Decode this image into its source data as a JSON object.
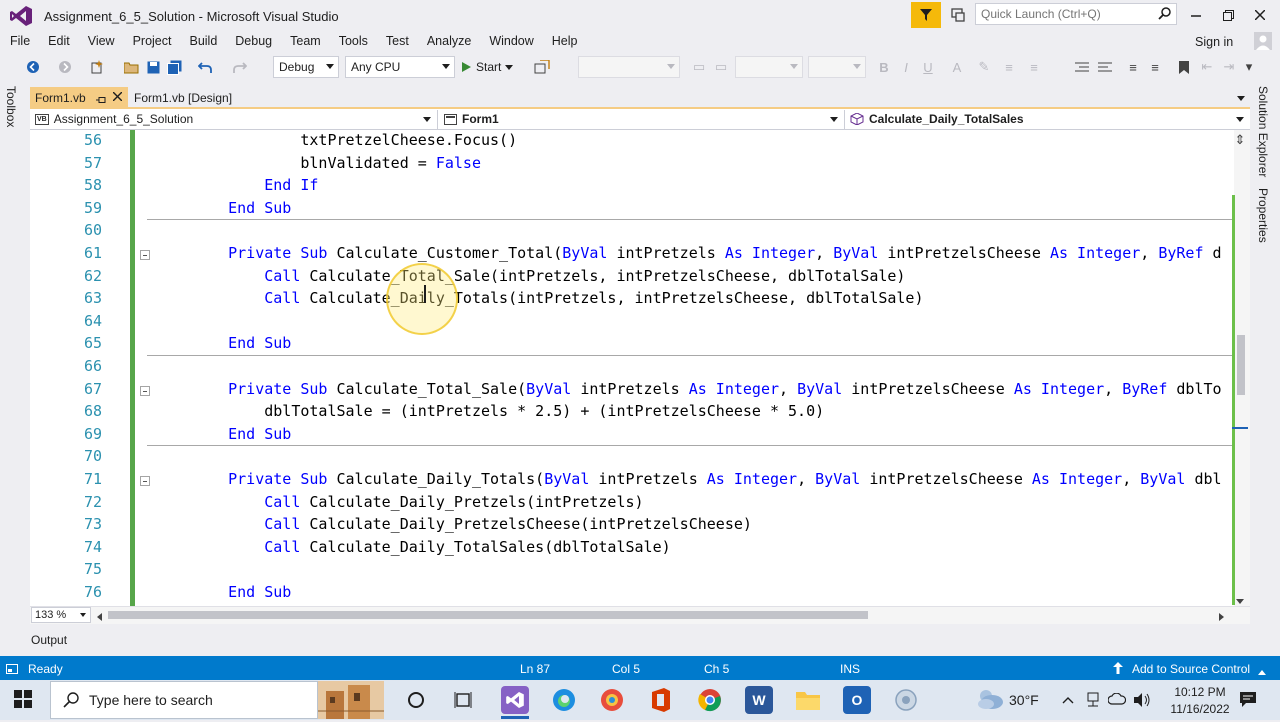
{
  "window": {
    "title": "Assignment_6_5_Solution - Microsoft Visual Studio",
    "quick_launch_placeholder": "Quick Launch (Ctrl+Q)"
  },
  "menu": [
    "File",
    "Edit",
    "View",
    "Project",
    "Build",
    "Debug",
    "Team",
    "Tools",
    "Test",
    "Analyze",
    "Window",
    "Help"
  ],
  "sign_in": "Sign in",
  "toolbar": {
    "config": "Debug",
    "platform": "Any CPU",
    "start_label": "Start"
  },
  "side_panels": {
    "toolbox": "Toolbox",
    "solution_explorer": "Solution Explorer",
    "properties": "Properties"
  },
  "tabs": [
    {
      "label": "Form1.vb",
      "active": true
    },
    {
      "label": "Form1.vb [Design]",
      "active": false
    }
  ],
  "navbar": {
    "project_badge": "VB",
    "project": "Assignment_6_5_Solution",
    "class": "Form1",
    "member": "Calculate_Daily_TotalSales"
  },
  "editor": {
    "lines": [
      {
        "n": "56",
        "parts": [
          {
            "t": "            txtPretzelCheese.Focus()",
            "k": false
          }
        ]
      },
      {
        "n": "57",
        "parts": [
          {
            "t": "            blnValidated = ",
            "k": false
          },
          {
            "t": "False",
            "k": true
          }
        ]
      },
      {
        "n": "58",
        "parts": [
          {
            "t": "        ",
            "k": false
          },
          {
            "t": "End If",
            "k": true
          }
        ]
      },
      {
        "n": "59",
        "parts": [
          {
            "t": "    ",
            "k": false
          },
          {
            "t": "End Sub",
            "k": true
          }
        ]
      },
      {
        "n": "60",
        "parts": []
      },
      {
        "n": "61",
        "parts": [
          {
            "t": "    ",
            "k": false
          },
          {
            "t": "Private Sub",
            "k": true
          },
          {
            "t": " Calculate_Customer_Total(",
            "k": false
          },
          {
            "t": "ByVal",
            "k": true
          },
          {
            "t": " intPretzels ",
            "k": false
          },
          {
            "t": "As Integer",
            "k": true
          },
          {
            "t": ", ",
            "k": false
          },
          {
            "t": "ByVal",
            "k": true
          },
          {
            "t": " intPretzelsCheese ",
            "k": false
          },
          {
            "t": "As Integer",
            "k": true
          },
          {
            "t": ", ",
            "k": false
          },
          {
            "t": "ByRef",
            "k": true
          },
          {
            "t": " d",
            "k": false
          }
        ]
      },
      {
        "n": "62",
        "parts": [
          {
            "t": "        ",
            "k": false
          },
          {
            "t": "Call",
            "k": true
          },
          {
            "t": " Calculate_Total_Sale(intPretzels, intPretzelsCheese, dblTotalSale)",
            "k": false
          }
        ]
      },
      {
        "n": "63",
        "parts": [
          {
            "t": "        ",
            "k": false
          },
          {
            "t": "Call",
            "k": true
          },
          {
            "t": " Calculate_Daily_Totals(intPretzels, intPretzelsCheese, dblTotalSale)",
            "k": false
          }
        ]
      },
      {
        "n": "64",
        "parts": []
      },
      {
        "n": "65",
        "parts": [
          {
            "t": "    ",
            "k": false
          },
          {
            "t": "End Sub",
            "k": true
          }
        ]
      },
      {
        "n": "66",
        "parts": []
      },
      {
        "n": "67",
        "parts": [
          {
            "t": "    ",
            "k": false
          },
          {
            "t": "Private Sub",
            "k": true
          },
          {
            "t": " Calculate_Total_Sale(",
            "k": false
          },
          {
            "t": "ByVal",
            "k": true
          },
          {
            "t": " intPretzels ",
            "k": false
          },
          {
            "t": "As Integer",
            "k": true
          },
          {
            "t": ", ",
            "k": false
          },
          {
            "t": "ByVal",
            "k": true
          },
          {
            "t": " intPretzelsCheese ",
            "k": false
          },
          {
            "t": "As Integer",
            "k": true
          },
          {
            "t": ", ",
            "k": false
          },
          {
            "t": "ByRef",
            "k": true
          },
          {
            "t": " dblTo",
            "k": false
          }
        ]
      },
      {
        "n": "68",
        "parts": [
          {
            "t": "        dblTotalSale = (intPretzels * 2.5) + (intPretzelsCheese * 5.0)",
            "k": false
          }
        ]
      },
      {
        "n": "69",
        "parts": [
          {
            "t": "    ",
            "k": false
          },
          {
            "t": "End Sub",
            "k": true
          }
        ]
      },
      {
        "n": "70",
        "parts": []
      },
      {
        "n": "71",
        "parts": [
          {
            "t": "    ",
            "k": false
          },
          {
            "t": "Private Sub",
            "k": true
          },
          {
            "t": " Calculate_Daily_Totals(",
            "k": false
          },
          {
            "t": "ByVal",
            "k": true
          },
          {
            "t": " intPretzels ",
            "k": false
          },
          {
            "t": "As Integer",
            "k": true
          },
          {
            "t": ", ",
            "k": false
          },
          {
            "t": "ByVal",
            "k": true
          },
          {
            "t": " intPretzelsCheese ",
            "k": false
          },
          {
            "t": "As Integer",
            "k": true
          },
          {
            "t": ", ",
            "k": false
          },
          {
            "t": "ByVal",
            "k": true
          },
          {
            "t": " dbl",
            "k": false
          }
        ]
      },
      {
        "n": "72",
        "parts": [
          {
            "t": "        ",
            "k": false
          },
          {
            "t": "Call",
            "k": true
          },
          {
            "t": " Calculate_Daily_Pretzels(intPretzels)",
            "k": false
          }
        ]
      },
      {
        "n": "73",
        "parts": [
          {
            "t": "        ",
            "k": false
          },
          {
            "t": "Call",
            "k": true
          },
          {
            "t": " Calculate_Daily_PretzelsCheese(intPretzelsCheese)",
            "k": false
          }
        ]
      },
      {
        "n": "74",
        "parts": [
          {
            "t": "        ",
            "k": false
          },
          {
            "t": "Call",
            "k": true
          },
          {
            "t": " Calculate_Daily_TotalSales(dblTotalSale)",
            "k": false
          }
        ]
      },
      {
        "n": "75",
        "parts": []
      },
      {
        "n": "76",
        "parts": [
          {
            "t": "    ",
            "k": false
          },
          {
            "t": "End Sub",
            "k": true
          }
        ]
      }
    ],
    "zoom": "133 %"
  },
  "output_label": "Output",
  "status": {
    "ready": "Ready",
    "ln": "Ln 87",
    "col": "Col 5",
    "ch": "Ch 5",
    "ins": "INS",
    "source_control": "Add to Source Control"
  },
  "taskbar": {
    "search_placeholder": "Type here to search",
    "temperature": "30°F",
    "time": "10:12 PM",
    "date": "11/16/2022"
  },
  "colors": {
    "accent": "#007acc",
    "tab_active": "#f5cc84",
    "keyword": "#0000ff",
    "line_number": "#2b91af",
    "change_bar": "#57a64a"
  }
}
